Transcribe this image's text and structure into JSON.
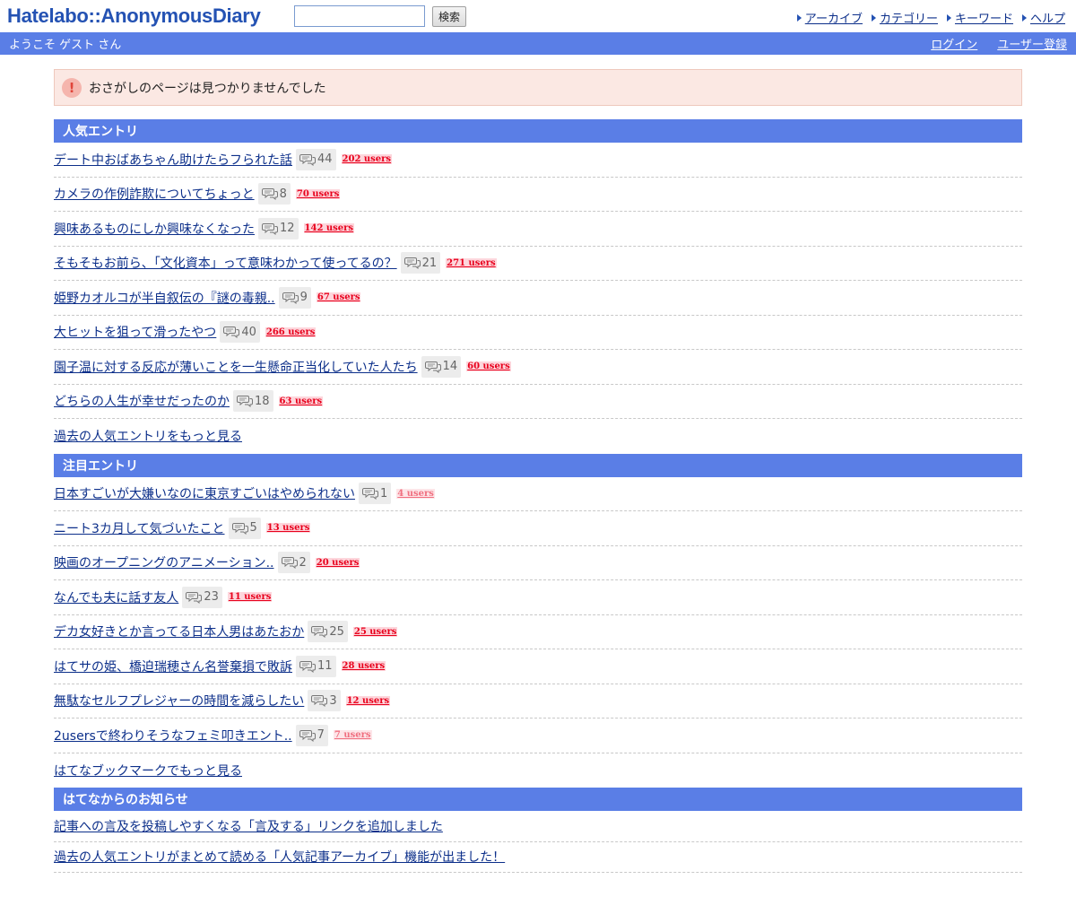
{
  "header": {
    "logo": "Hatelabo::AnonymousDiary",
    "search_button": "検索",
    "nav": [
      {
        "label": "アーカイブ"
      },
      {
        "label": "カテゴリー"
      },
      {
        "label": "キーワード"
      },
      {
        "label": "ヘルプ"
      }
    ]
  },
  "userbar": {
    "welcome": "ようこそ ゲスト さん",
    "login": "ログイン",
    "register": "ユーザー登録"
  },
  "alert": {
    "icon": "!",
    "message": "おさがしのページは見つかりませんでした"
  },
  "popular": {
    "heading": "人気エントリ",
    "items": [
      {
        "title": "デート中おばあちゃん助けたらフられた話",
        "comments": "44",
        "users": "202 users",
        "style": "strong"
      },
      {
        "title": "カメラの作例詐欺についてちょっと",
        "comments": "8",
        "users": "70 users",
        "style": "strong"
      },
      {
        "title": "興味あるものにしか興味なくなった",
        "comments": "12",
        "users": "142 users",
        "style": "strong"
      },
      {
        "title": "そもそもお前ら、「文化資本」って意味わかって使ってるの？",
        "comments": "21",
        "users": "271 users",
        "style": "strong"
      },
      {
        "title": "姫野カオルコが半自叙伝の『謎の毒親..",
        "comments": "9",
        "users": "67 users",
        "style": "strong"
      },
      {
        "title": "大ヒットを狙って滑ったやつ",
        "comments": "40",
        "users": "266 users",
        "style": "strong"
      },
      {
        "title": "園子温に対する反応が薄いことを一生懸命正当化していた人たち",
        "comments": "14",
        "users": "60 users",
        "style": "strong"
      },
      {
        "title": "どちらの人生が幸せだったのか",
        "comments": "18",
        "users": "63 users",
        "style": "strong"
      }
    ],
    "more": "過去の人気エントリをもっと見る"
  },
  "featured": {
    "heading": "注目エントリ",
    "items": [
      {
        "title": "日本すごいが大嫌いなのに東京すごいはやめられない",
        "comments": "1",
        "users": "4 users",
        "style": "light"
      },
      {
        "title": "ニート3カ月して気づいたこと",
        "comments": "5",
        "users": "13 users",
        "style": "strong"
      },
      {
        "title": "映画のオープニングのアニメーション..",
        "comments": "2",
        "users": "20 users",
        "style": "strong"
      },
      {
        "title": "なんでも夫に話す友人",
        "comments": "23",
        "users": "11 users",
        "style": "strong"
      },
      {
        "title": "デカ女好きとか言ってる日本人男はあたおか",
        "comments": "25",
        "users": "25 users",
        "style": "strong"
      },
      {
        "title": "はてサの姫、橋迫瑞穂さん名誉棄損で敗訴",
        "comments": "11",
        "users": "28 users",
        "style": "strong"
      },
      {
        "title": "無駄なセルフプレジャーの時間を減らしたい",
        "comments": "3",
        "users": "12 users",
        "style": "strong"
      },
      {
        "title": "2usersで終わりそうなフェミ叩きエント..",
        "comments": "7",
        "users": "7 users",
        "style": "light"
      }
    ],
    "more": "はてなブックマークでもっと見る"
  },
  "notice": {
    "heading": "はてなからのお知らせ",
    "items": [
      {
        "title": "記事への言及を投稿しやすくなる「言及する」リンクを追加しました"
      },
      {
        "title": "過去の人気エントリがまとめて読める「人気記事アーカイブ」機能が出ました！"
      }
    ]
  },
  "icons": {
    "comment": "comment-icon",
    "alert": "exclamation-icon",
    "nav_arrow": "triangle-right-icon"
  },
  "colors": {
    "brand": "#2452b3",
    "bar": "#5a7ee6",
    "link": "#0c2f8a",
    "users_strong": "#e8001c",
    "users_light": "#f07080",
    "alert_bg": "#fbe8e3"
  }
}
